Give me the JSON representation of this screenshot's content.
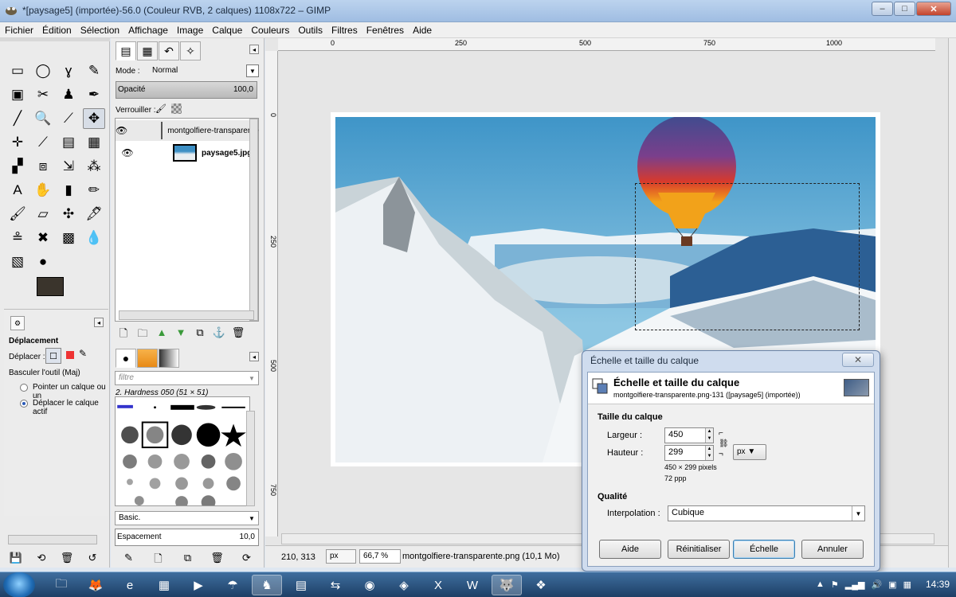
{
  "window": {
    "title": "*[paysage5] (importée)-56.0 (Couleur RVB, 2 calques) 1108x722 – GIMP",
    "minimize": "–",
    "maximize": "□",
    "close": "✕"
  },
  "menu": [
    "Fichier",
    "Édition",
    "Sélection",
    "Affichage",
    "Image",
    "Calque",
    "Couleurs",
    "Outils",
    "Filtres",
    "Fenêtres",
    "Aide"
  ],
  "toolbox": {
    "tools": [
      "▭",
      "◯",
      "ɣ",
      "✎",
      "▣",
      "✂",
      "♟",
      "✒",
      "╱",
      "🔍",
      "⟋",
      "✥",
      "✛",
      "⟋",
      "▤",
      "▦",
      "▞",
      "⧈",
      "⇲",
      "⁂",
      "A",
      "✋",
      "▮",
      "✏",
      "🖌",
      "▱",
      "✣",
      "🖋",
      "≗",
      "✖",
      "▩",
      "💧",
      "▧",
      "●"
    ],
    "options_title": "Déplacement",
    "move_label": "Déplacer :",
    "switch_label": "Basculer l'outil  (Maj)",
    "radio1": "Pointer un calque ou un",
    "radio2": "Déplacer le calque actif"
  },
  "layers": {
    "mode_label": "Mode :",
    "mode_value": "Normal",
    "opacity_label": "Opacité",
    "opacity_value": "100,0",
    "lock_label": "Verrouiller :",
    "items": [
      {
        "name": "montgolfiere-transparente",
        "visible": "👁"
      },
      {
        "name": "paysage5.jpg",
        "visible": "👁"
      }
    ]
  },
  "brushes": {
    "filter_placeholder": "filtre",
    "brush_name": "2. Hardness 050 (51 × 51)",
    "preset": "Basic.",
    "spacing_label": "Espacement",
    "spacing_value": "10,0"
  },
  "ruler": {
    "h": [
      "0",
      "250",
      "500",
      "750",
      "1000"
    ],
    "v": [
      "0",
      "250",
      "500",
      "750"
    ]
  },
  "status": {
    "coords": "210, 313",
    "unit": "px",
    "zoom": "66,7 %",
    "file": "montgolfiere-transparente.png (10,1 Mo)"
  },
  "dialog": {
    "window_title": "Échelle et taille du calque",
    "header_title": "Échelle et taille du calque",
    "header_sub": "montgolfiere-transparente.png-131 ([paysage5] (importée))",
    "size_section": "Taille du calque",
    "width_label": "Largeur :",
    "width_value": "450",
    "height_label": "Hauteur :",
    "height_value": "299",
    "size_info": "450 × 299 pixels",
    "resolution": "72 ppp",
    "unit": "px",
    "quality_section": "Qualité",
    "interp_label": "Interpolation :",
    "interp_value": "Cubique",
    "btn_help": "Aide",
    "btn_reset": "Réinitialiser",
    "btn_scale": "Échelle",
    "btn_cancel": "Annuler"
  },
  "taskbar": {
    "items": [
      "🗀",
      "🦊",
      "e",
      "▦",
      "▶",
      "☂",
      "♞",
      "▤",
      "⇆",
      "◉",
      "◈",
      "X",
      "W",
      "🐺",
      "❖"
    ],
    "clock": "14:39"
  }
}
